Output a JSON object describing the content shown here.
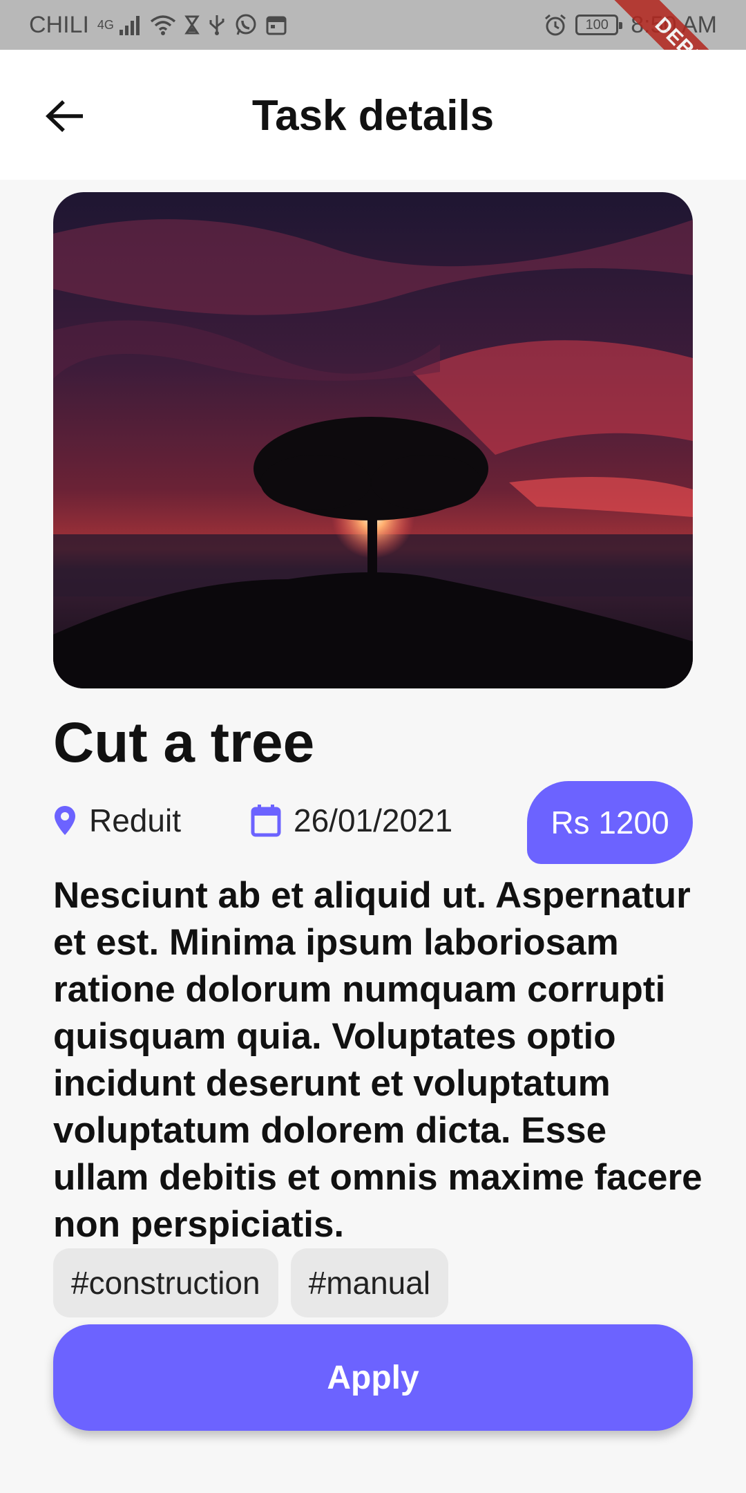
{
  "status_bar": {
    "carrier": "CHILI",
    "network": "4G",
    "battery": "100",
    "time": "8:50 AM"
  },
  "debug_banner": "DEBUG",
  "app_bar": {
    "title": "Task details"
  },
  "task": {
    "title": "Cut a tree",
    "location": "Reduit",
    "date": "26/01/2021",
    "price": "Rs 1200",
    "description": "Nesciunt ab et aliquid ut. Aspernatur et est. Minima ipsum laboriosam ratione dolorum numquam corrupti quisquam quia. Voluptates optio incidunt deserunt et voluptatum voluptatum dolorem dicta. Esse ullam debitis et omnis maxime facere non perspiciatis.",
    "tags": [
      "#construction",
      "#manual"
    ]
  },
  "actions": {
    "apply_label": "Apply"
  },
  "colors": {
    "accent": "#6c63ff",
    "tag_bg": "#e8e8e8",
    "status_bar_bg": "#b8b8b8"
  }
}
